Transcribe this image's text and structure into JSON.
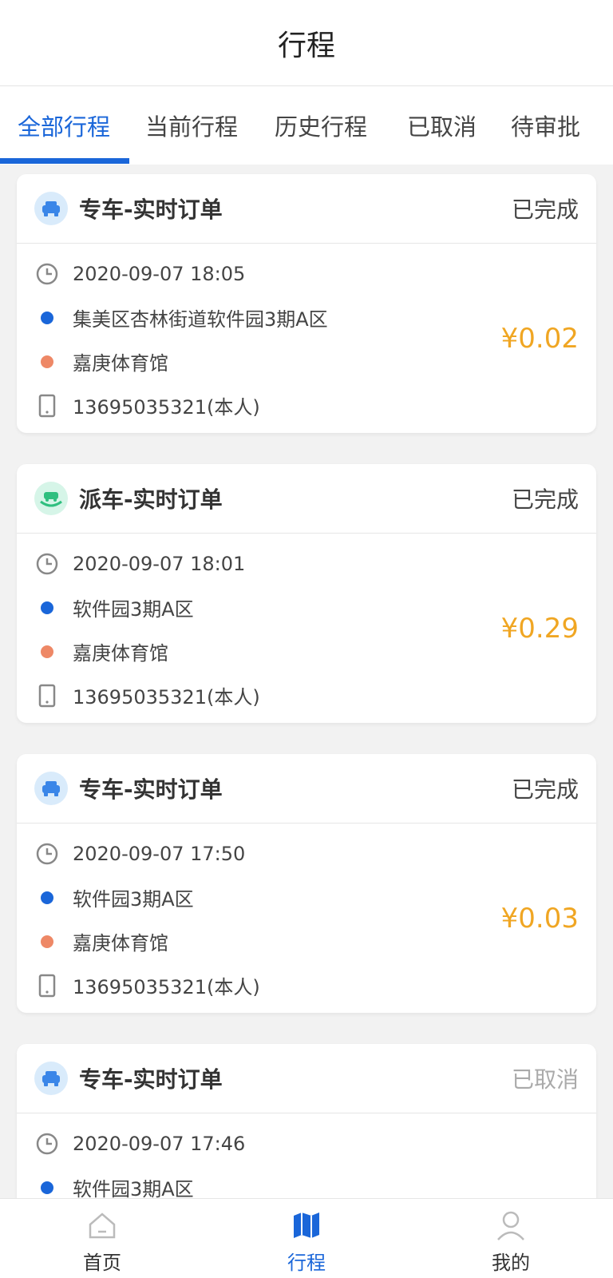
{
  "header": {
    "title": "行程"
  },
  "tabs": [
    {
      "label": "全部行程",
      "active": true
    },
    {
      "label": "当前行程",
      "active": false
    },
    {
      "label": "历史行程",
      "active": false
    },
    {
      "label": "已取消",
      "active": false
    },
    {
      "label": "待审批",
      "active": false
    }
  ],
  "orders": [
    {
      "type": "专车-实时订单",
      "icon": "vip-car-icon",
      "status": "已完成",
      "time": "2020-09-07 18:05",
      "start": "集美区杏林街道软件园3期A区",
      "end": "嘉庚体育馆",
      "phone": "13695035321(本人)",
      "price": "¥0.02"
    },
    {
      "type": "派车-实时订单",
      "icon": "dispatch-car-icon",
      "status": "已完成",
      "time": "2020-09-07 18:01",
      "start": "软件园3期A区",
      "end": "嘉庚体育馆",
      "phone": "13695035321(本人)",
      "price": "¥0.29"
    },
    {
      "type": "专车-实时订单",
      "icon": "vip-car-icon",
      "status": "已完成",
      "time": "2020-09-07 17:50",
      "start": "软件园3期A区",
      "end": "嘉庚体育馆",
      "phone": "13695035321(本人)",
      "price": "¥0.03"
    },
    {
      "type": "专车-实时订单",
      "icon": "vip-car-icon",
      "status": "已取消",
      "time": "2020-09-07 17:46",
      "start": "软件园3期A区"
    }
  ],
  "tabbar": [
    {
      "label": "首页",
      "icon": "home-icon",
      "active": false
    },
    {
      "label": "行程",
      "icon": "map-icon",
      "active": true
    },
    {
      "label": "我的",
      "icon": "user-icon",
      "active": false
    }
  ],
  "colors": {
    "accent": "#1a66d9",
    "price": "#f0a623",
    "start_dot": "#1a66d9",
    "end_dot": "#ee8866"
  }
}
